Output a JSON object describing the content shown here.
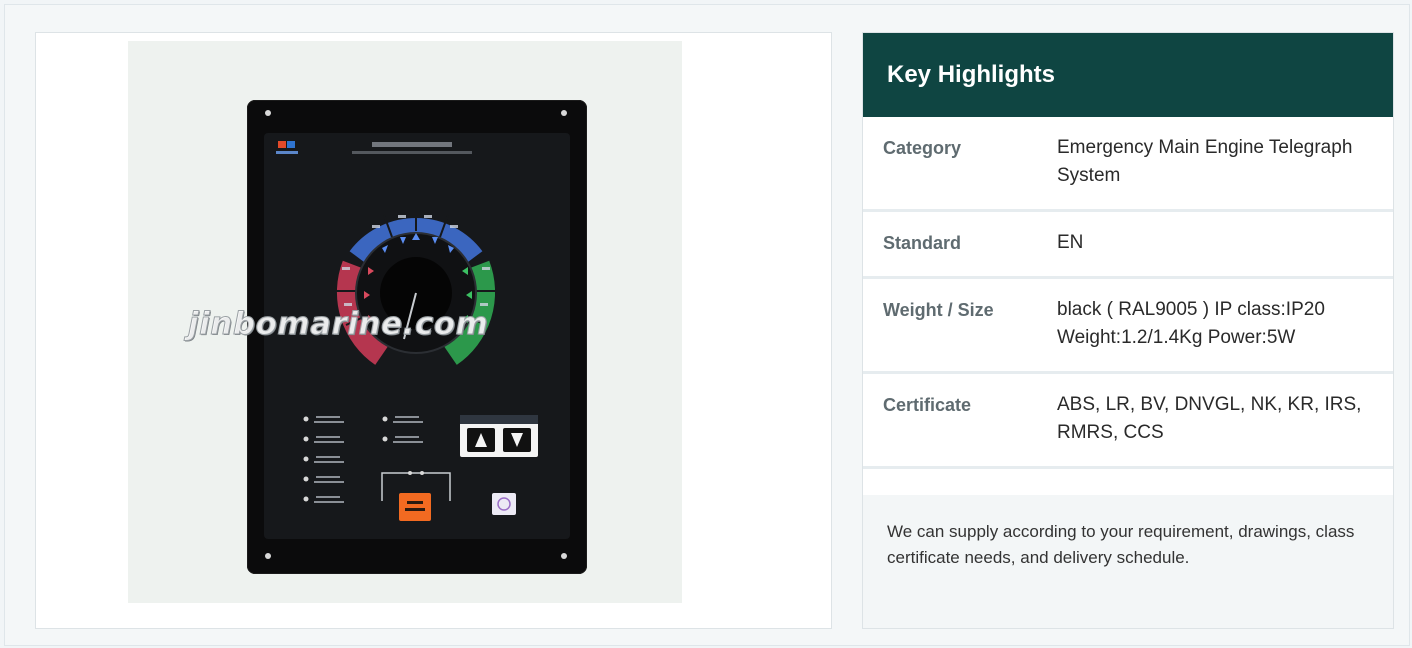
{
  "watermark": "jinbomarine.com",
  "highlights": {
    "title": "Key Highlights",
    "rows": [
      {
        "label": "Category",
        "value": "Emergency Main Engine Telegraph System"
      },
      {
        "label": "Standard",
        "value": "EN"
      },
      {
        "label": "Weight / Size",
        "value": "black ( RAL9005 ) IP class:IP20 Weight:1.2/1.4Kg Power:5W"
      },
      {
        "label": "Certificate",
        "value": "ABS, LR, BV, DNVGL, NK, KR, IRS, RMRS, CCS"
      }
    ],
    "note": "We can supply according to your requirement, drawings, class certificate needs, and delivery schedule."
  },
  "colors": {
    "header_bg": "#0f4542",
    "ring_blue": "#3f6fd1",
    "ring_red": "#c63a55",
    "ring_green": "#2fa651",
    "button_orange": "#f26a21"
  }
}
